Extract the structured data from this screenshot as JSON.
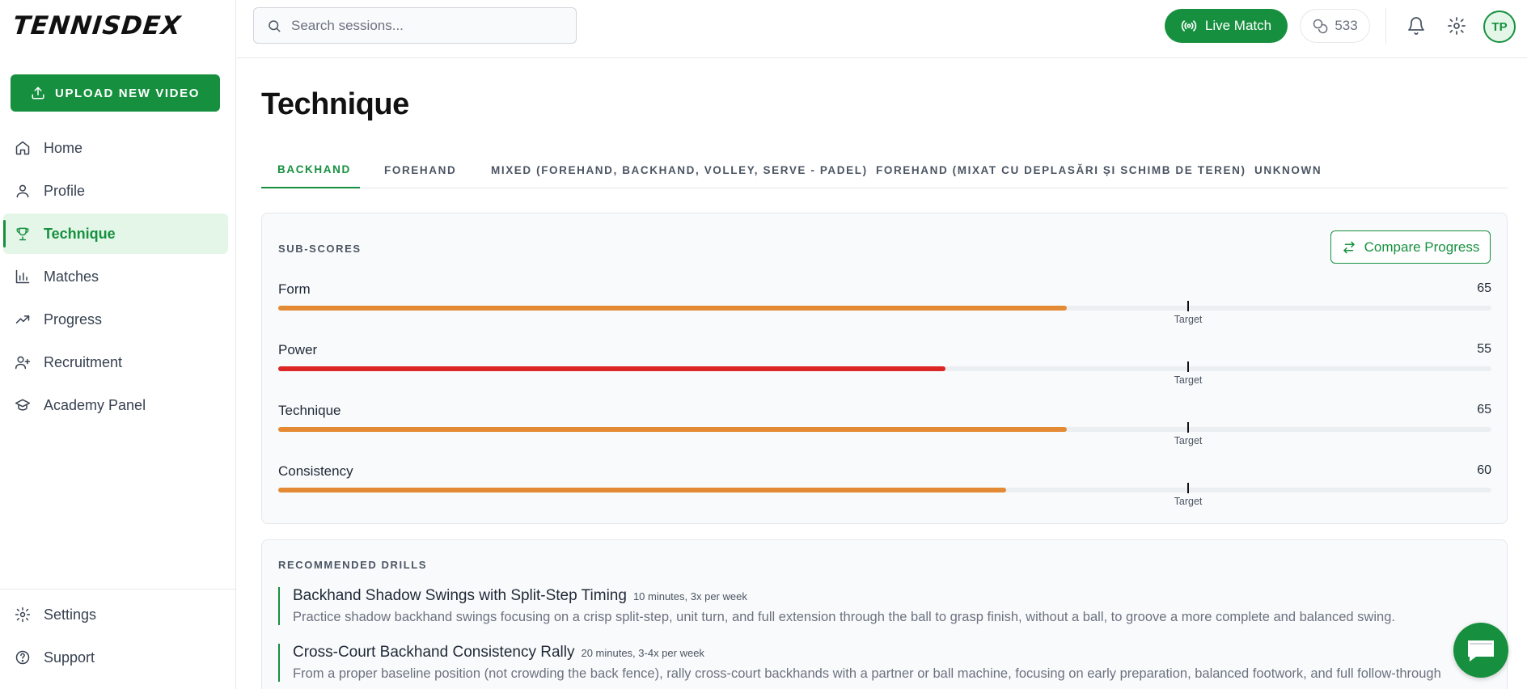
{
  "app": {
    "logo_text": "TENNISDEX"
  },
  "sidebar": {
    "upload_label": "UPLOAD NEW VIDEO",
    "items": [
      {
        "label": "Home",
        "icon": "home-icon"
      },
      {
        "label": "Profile",
        "icon": "user-icon"
      },
      {
        "label": "Technique",
        "icon": "trophy-icon",
        "active": true
      },
      {
        "label": "Matches",
        "icon": "bar-chart-icon"
      },
      {
        "label": "Progress",
        "icon": "trending-up-icon"
      },
      {
        "label": "Recruitment",
        "icon": "user-plus-icon"
      },
      {
        "label": "Academy Panel",
        "icon": "graduation-cap-icon"
      }
    ],
    "bottom_items": [
      {
        "label": "Settings",
        "icon": "gear-icon"
      },
      {
        "label": "Support",
        "icon": "help-circle-icon"
      }
    ]
  },
  "header": {
    "search_placeholder": "Search sessions...",
    "live_match_label": "Live Match",
    "credits": "533",
    "avatar_initials": "TP"
  },
  "main": {
    "title": "Technique",
    "tabs": [
      {
        "label": "BACKHAND",
        "active": true
      },
      {
        "label": "FOREHAND"
      },
      {
        "label": "MIXED (FOREHAND, BACKHAND, VOLLEY, SERVE - PADEL)"
      },
      {
        "label": "FOREHAND (MIXAT CU DEPLASĂRI ȘI SCHIMB DE TEREN)"
      },
      {
        "label": "UNKNOWN"
      }
    ],
    "subscores": {
      "label": "SUB-SCORES",
      "compare_label": "Compare Progress",
      "target_label": "Target",
      "target_value": 75,
      "max": 100,
      "items": [
        {
          "name": "Form",
          "value": 65,
          "color": "#e58a34"
        },
        {
          "name": "Power",
          "value": 55,
          "color": "#dc2626"
        },
        {
          "name": "Technique",
          "value": 65,
          "color": "#e58a34"
        },
        {
          "name": "Consistency",
          "value": 60,
          "color": "#e58a34"
        }
      ]
    },
    "drills": {
      "label": "RECOMMENDED DRILLS",
      "items": [
        {
          "title": "Backhand Shadow Swings with Split-Step Timing",
          "meta": "10 minutes, 3x per week",
          "desc": "Practice shadow backhand swings focusing on a crisp split-step, unit turn, and full extension through the ball to grasp finish, without a ball, to groove a more complete and balanced swing."
        },
        {
          "title": "Cross-Court Backhand Consistency Rally",
          "meta": "20 minutes, 3-4x per week",
          "desc": "From a proper baseline position (not crowding the back fence), rally cross-court backhands with a partner or ball machine, focusing on early preparation, balanced footwork, and full follow-through"
        }
      ]
    }
  },
  "colors": {
    "brand": "#16903f",
    "brand_light": "#e3f6e8",
    "warning": "#e58a34",
    "danger": "#dc2626"
  }
}
